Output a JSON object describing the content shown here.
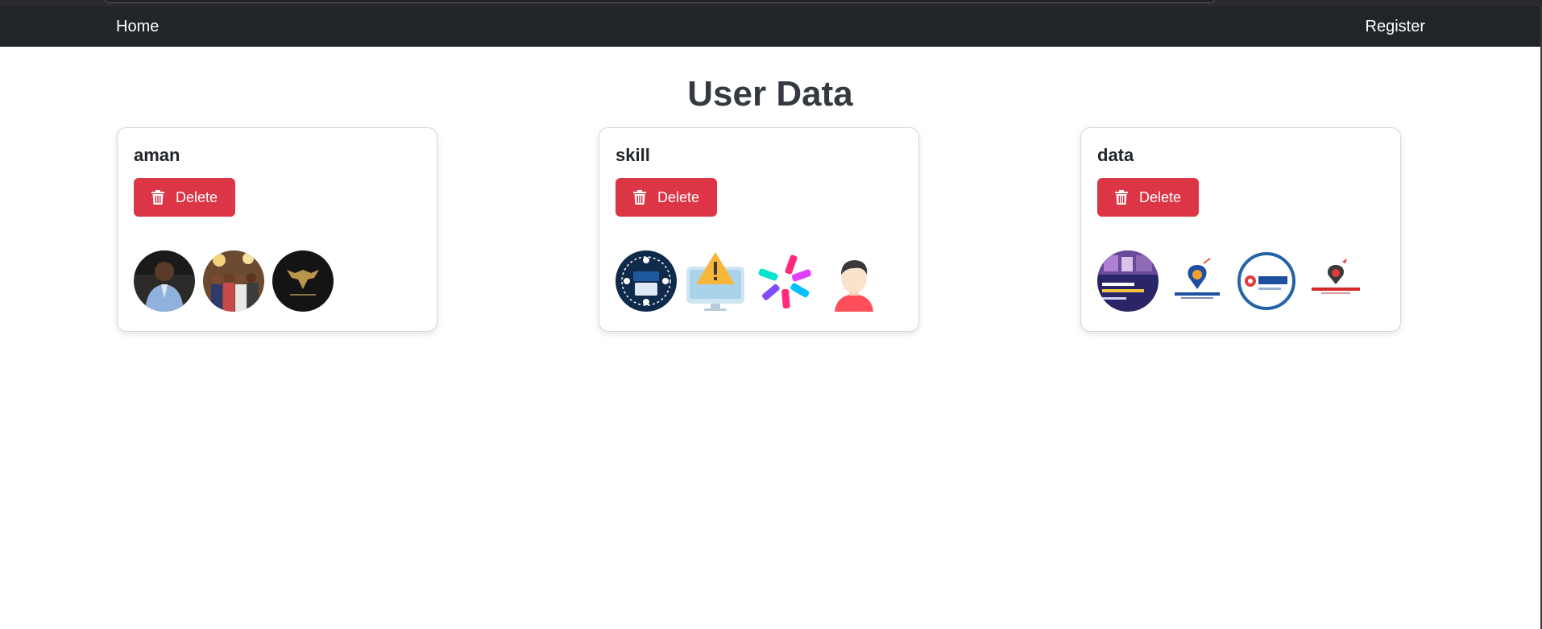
{
  "nav": {
    "home": "Home",
    "register": "Register"
  },
  "page": {
    "title": "User Data"
  },
  "users": [
    {
      "name": "aman",
      "delete_label": "Delete"
    },
    {
      "name": "skill",
      "delete_label": "Delete"
    },
    {
      "name": "data",
      "delete_label": "Delete"
    }
  ],
  "colors": {
    "navbar": "#212529",
    "danger": "#dc3545",
    "title": "#343a40"
  }
}
